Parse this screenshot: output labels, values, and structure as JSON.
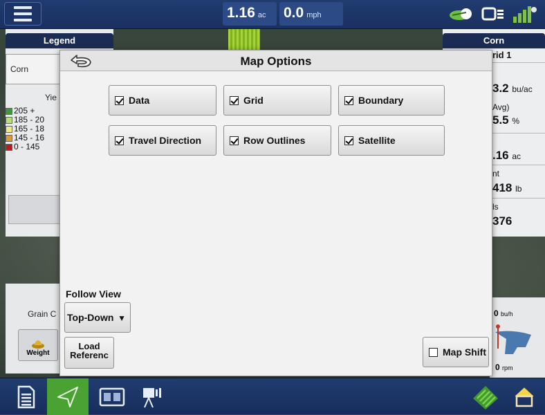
{
  "topbar": {
    "area_value": "1.16",
    "area_unit": "ac",
    "speed_value": "0.0",
    "speed_unit": "mph"
  },
  "legend_panel": {
    "header": "Legend",
    "crop_dropdown": "Corn",
    "legend_title": "Yie",
    "legend_rows": [
      {
        "label": "205 +",
        "color": "#3b9a3b"
      },
      {
        "label": "185 - 20",
        "color": "#b8e07a"
      },
      {
        "label": "165 - 18",
        "color": "#f1e889"
      },
      {
        "label": "145 - 16",
        "color": "#d89a3c"
      },
      {
        "label": "0 - 145",
        "color": "#b71b1b"
      }
    ]
  },
  "right_panel": {
    "header": "Corn",
    "subheader": "rid 1",
    "yield_value": "3.2",
    "yield_unit": "bu/ac",
    "avg_label": "Avg)",
    "moisture_value": "5.5",
    "moisture_unit": "%",
    "area_value": ".16",
    "area_unit": "ac",
    "weight_label": "nt",
    "weight_value": "418",
    "weight_unit": "lb",
    "count_label": "ls",
    "count_value": "376"
  },
  "lower_left": {
    "grain_label": "Grain C",
    "weight_button": "Weight"
  },
  "lower_right": {
    "flow_value": "0",
    "flow_unit": "bu/h",
    "rpm_value": "0",
    "rpm_unit": "rpm"
  },
  "modal": {
    "title": "Map Options",
    "options": [
      {
        "label": "Data",
        "checked": true
      },
      {
        "label": "Grid",
        "checked": true
      },
      {
        "label": "Boundary",
        "checked": true
      },
      {
        "label": "Travel Direction",
        "checked": true
      },
      {
        "label": "Row Outlines",
        "checked": true
      },
      {
        "label": "Satellite",
        "checked": true
      }
    ],
    "follow_view_label": "Follow View",
    "follow_view_value": "Top-Down",
    "load_reference_label_line1": "Load",
    "load_reference_label_line2": "Referenc",
    "map_shift_label": "Map Shift",
    "map_shift_checked": false
  },
  "colors": {
    "topbar": "#203c70",
    "active_nav": "#4aa232",
    "modal_bg": "#f2f2f2"
  },
  "icons": {
    "menu": "hamburger-icon",
    "back": "back-arrow-icon",
    "nav": [
      "document-icon",
      "navigation-arrow-icon",
      "split-screen-icon",
      "camera-icon"
    ],
    "right_nav": [
      "field-icon",
      "home-icon"
    ]
  }
}
